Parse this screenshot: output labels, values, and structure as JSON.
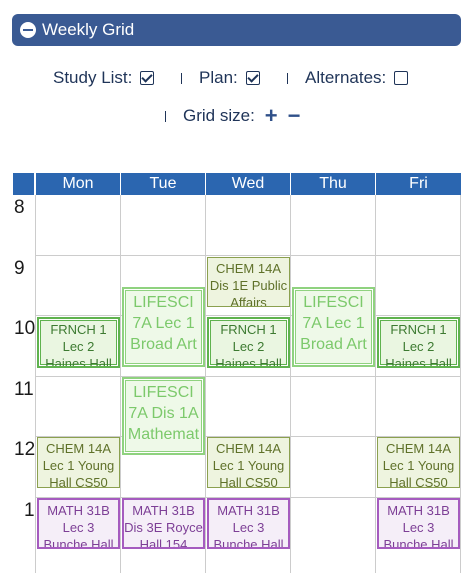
{
  "header": {
    "title": "Weekly Grid",
    "toggle_icon": "minus-circle-icon"
  },
  "options": {
    "study_list": {
      "label": "Study List:",
      "checked": true
    },
    "plan": {
      "label": "Plan:",
      "checked": true
    },
    "alternates": {
      "label": "Alternates:",
      "checked": false
    },
    "grid_size": {
      "label": "Grid size:",
      "increase": "+",
      "decrease": "−"
    }
  },
  "days": [
    "Mon",
    "Tue",
    "Wed",
    "Thu",
    "Fri"
  ],
  "hours": [
    "8",
    "9",
    "10",
    "11",
    "12",
    "1"
  ],
  "colors": {
    "header": "#3a5a93",
    "day_bar": "#2b66b0",
    "enrolled": "#5fb24e",
    "planned": "#8fd27f",
    "olive": "#8ba04f",
    "math": "#a55bbf"
  },
  "blocks": [
    {
      "id": "wed-chem-dis",
      "lines": [
        "CHEM 14A",
        "Dis 1E Public",
        "Affairs"
      ]
    },
    {
      "id": "tue-lifesci-lec",
      "lines": [
        "LIFESCI",
        "7A Lec 1",
        "Broad Art"
      ]
    },
    {
      "id": "thu-lifesci-lec",
      "lines": [
        "LIFESCI",
        "7A Lec 1",
        "Broad Art"
      ]
    },
    {
      "id": "mon-frnch",
      "lines": [
        "FRNCH 1",
        "Lec 2",
        "Haines Hall"
      ]
    },
    {
      "id": "wed-frnch",
      "lines": [
        "FRNCH 1",
        "Lec 2",
        "Haines Hall"
      ]
    },
    {
      "id": "fri-frnch",
      "lines": [
        "FRNCH 1",
        "Lec 2",
        "Haines Hall"
      ]
    },
    {
      "id": "tue-lifesci-dis",
      "lines": [
        "LIFESCI",
        "7A Dis 1A",
        "Mathemat"
      ]
    },
    {
      "id": "mon-chem",
      "lines": [
        "CHEM 14A",
        "Lec 1 Young",
        "Hall CS50"
      ]
    },
    {
      "id": "wed-chem",
      "lines": [
        "CHEM 14A",
        "Lec 1 Young",
        "Hall CS50"
      ]
    },
    {
      "id": "fri-chem",
      "lines": [
        "CHEM 14A",
        "Lec 1 Young",
        "Hall CS50"
      ]
    },
    {
      "id": "mon-math",
      "lines": [
        "MATH 31B",
        "Lec 3",
        "Bunche Hall"
      ]
    },
    {
      "id": "tue-math-dis",
      "lines": [
        "MATH 31B",
        "Dis 3E Royce",
        "Hall 154"
      ]
    },
    {
      "id": "wed-math",
      "lines": [
        "MATH 31B",
        "Lec 3",
        "Bunche Hall"
      ]
    },
    {
      "id": "fri-math",
      "lines": [
        "MATH 31B",
        "Lec 3",
        "Bunche Hall"
      ]
    }
  ]
}
